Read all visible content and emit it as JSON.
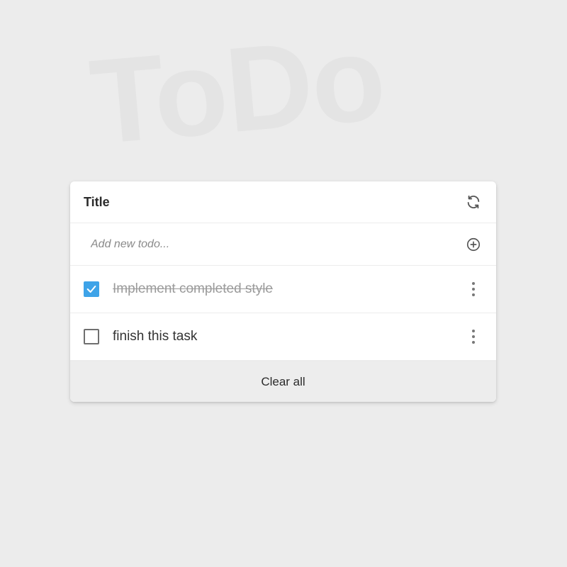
{
  "watermark": "ToDo",
  "card": {
    "title": "Title",
    "refresh_icon": "refresh-icon"
  },
  "add": {
    "placeholder": "Add new todo...",
    "value": "",
    "add_icon": "plus-circle-icon"
  },
  "todos": [
    {
      "text": "Implement completed style",
      "completed": true
    },
    {
      "text": "finish this task",
      "completed": false
    }
  ],
  "footer": {
    "clear_label": "Clear all"
  },
  "colors": {
    "background": "#ececec",
    "card": "#ffffff",
    "accent": "#3ea3e8",
    "footer": "#ededed",
    "completed_text": "#9a9a9a"
  }
}
